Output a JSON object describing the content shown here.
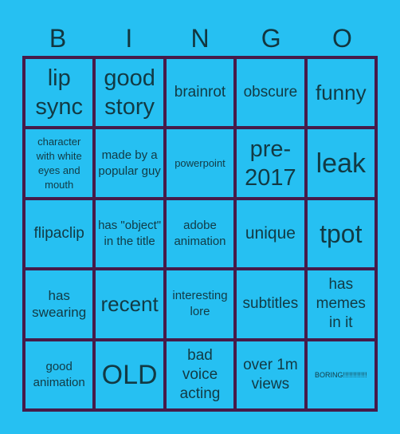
{
  "header": {
    "letters": [
      "B",
      "I",
      "N",
      "G",
      "O"
    ]
  },
  "colors": {
    "background": "#26c0f2",
    "grid_lines": "#461b49",
    "text": "#12363f"
  },
  "cells": [
    [
      "lip sync",
      "good story",
      "brainrot",
      "obscure",
      "funny"
    ],
    [
      "character with white eyes and mouth",
      "made by a popular guy",
      "powerpoint",
      "pre-2017",
      "leak"
    ],
    [
      "flipaclip",
      "has \"object\" in the title",
      "adobe animation",
      "unique",
      "tpot"
    ],
    [
      "has swearing",
      "recent",
      "interesting lore",
      "subtitles",
      "has memes in it"
    ],
    [
      "good animation",
      "OLD",
      "bad voice acting",
      "over 1m views",
      "BORING!!!!!!!!!!!!"
    ]
  ]
}
